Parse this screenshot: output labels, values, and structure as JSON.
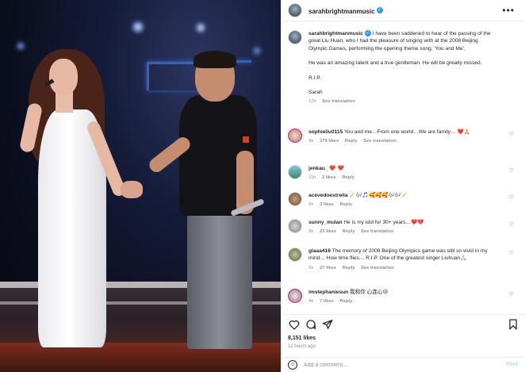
{
  "post": {
    "username": "sarahbrightmanmusic",
    "verified_mark": "✓",
    "more_label": "•••",
    "caption_p1": "I have been saddened to hear of the passing of the great Liu Huan, who I had the pleasure of singing with at the 2008 Beijing Olympic Games, performing the opening theme song, 'You and Me'.",
    "caption_p2": "He was an amazing talent and a true gentleman. He will be greatly missed.",
    "caption_p3": "R.I.P.",
    "caption_p4": "Sarah",
    "caption_time": "12h",
    "see_translation": "See translation"
  },
  "comments": [
    {
      "user": "sophieliu0115",
      "text": "You and me…From one world…We are family… ❤️🙏",
      "time": "9h",
      "likes": "179 likes",
      "reply": "Reply",
      "translation": "See translation"
    },
    {
      "user": "jenkau_",
      "text": "❤️ ❤️",
      "time": "11h",
      "likes": "2 likes",
      "reply": "Reply",
      "translation": ""
    },
    {
      "user": "acevedoestrella",
      "text": "🪄🎶🎵🥰🥰🥰🎶🎶🪄",
      "time": "6h",
      "likes": "2 likes",
      "reply": "Reply",
      "translation": ""
    },
    {
      "user": "sunny_mulan",
      "text": "He is my idol for 30+ years…❤️💔",
      "time": "9h",
      "likes": "23 likes",
      "reply": "Reply",
      "translation": "See translation"
    },
    {
      "user": "giaaa416",
      "text": "The memory of 2008 Beijing Olympics game was still so vivid in my mind… How time flies… R.I.P. One of the greatest singer Liuhuan🙏🏻",
      "time": "5h",
      "likes": "27 likes",
      "reply": "Reply",
      "translation": "See translation"
    },
    {
      "user": "imstephaniesun",
      "text": "我和你 心连心😢",
      "time": "4h",
      "likes": "7 likes",
      "reply": "Reply",
      "translation": ""
    }
  ],
  "actions": {
    "like_icon": "heart-icon",
    "comment_icon": "comment-icon",
    "share_icon": "share-icon",
    "save_icon": "bookmark-icon"
  },
  "likes_count": "8,151 likes",
  "time_ago": "12 hours ago",
  "comment_box": {
    "placeholder": "Add a comment…",
    "post_label": "Post",
    "emoji_icon": "emoji-icon"
  },
  "colors": {
    "verified": "#3897f0",
    "muted_text": "#8e8e8e",
    "post_button": "#b2dffc",
    "heart_red": "#ed4956"
  }
}
